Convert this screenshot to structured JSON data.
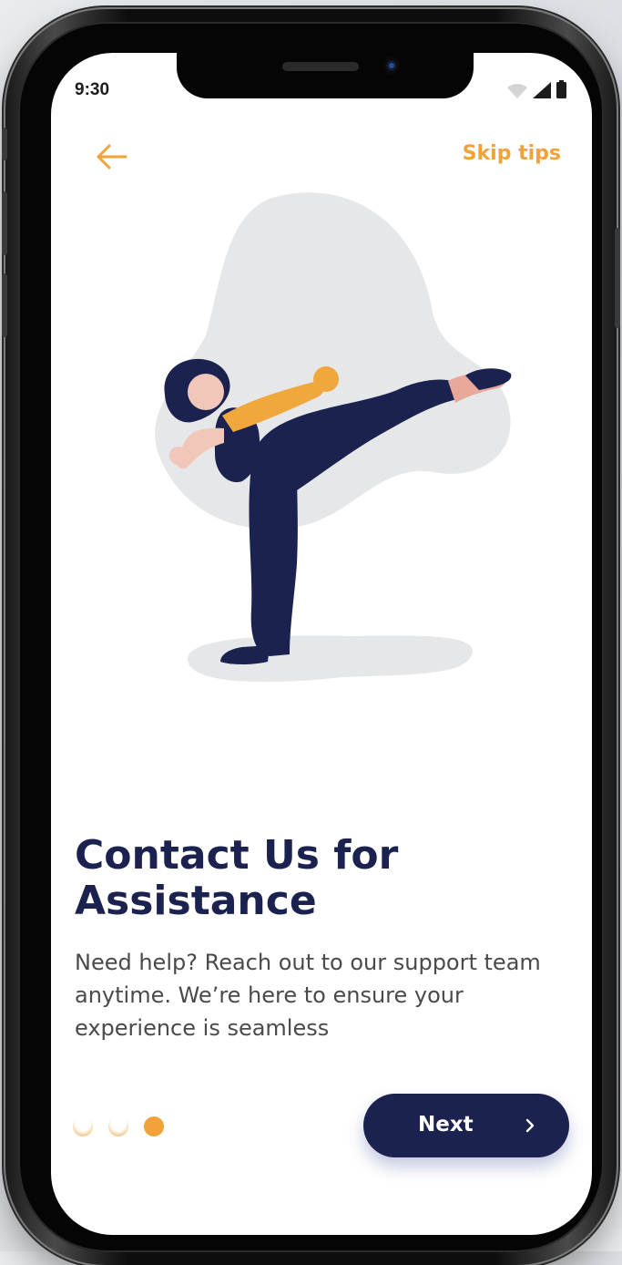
{
  "status_bar": {
    "time": "9:30",
    "icons": [
      "wifi-icon",
      "cellular-signal-icon",
      "battery-icon"
    ]
  },
  "header": {
    "back_icon": "arrow-left-icon",
    "skip_label": "Skip tips"
  },
  "onboarding": {
    "illustration": "woman-high-kick-with-prosthetic-arm",
    "title": "Contact Us for Assistance",
    "description": "Need help? Reach out to our support team anytime. We’re here to ensure your experience is seamless",
    "pagination": {
      "total": 3,
      "active_index": 2
    },
    "next_label": "Next",
    "next_icon": "chevron-right-icon"
  },
  "colors": {
    "accent": "#f2a23a",
    "primary": "#1b2250",
    "text_muted": "#4a4a4a",
    "blob": "#e6e7e8"
  }
}
